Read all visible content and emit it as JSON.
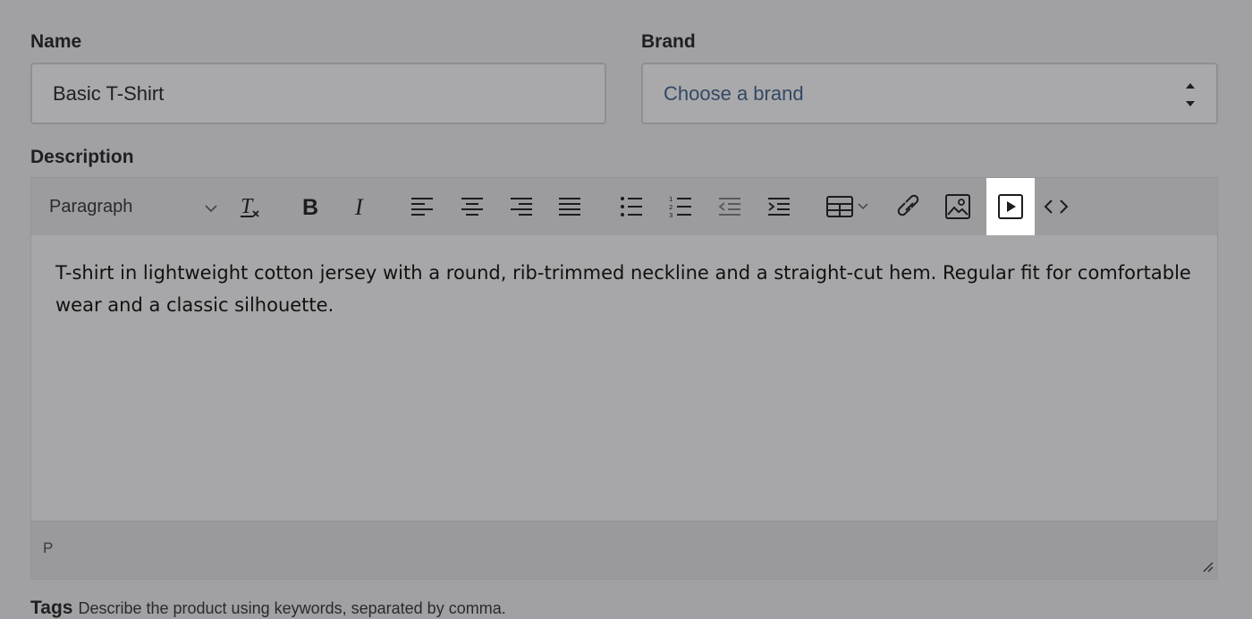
{
  "form": {
    "name_label": "Name",
    "name_value": "Basic T-Shirt",
    "brand_label": "Brand",
    "brand_placeholder": "Choose a brand",
    "description_label": "Description",
    "tags_label": "Tags",
    "tags_help": "Describe the product using keywords, separated by comma."
  },
  "editor": {
    "block_format": "Paragraph",
    "toolbar_icons": [
      "clear-formatting-icon",
      "bold-icon",
      "italic-icon",
      "align-left-icon",
      "align-center-icon",
      "align-right-icon",
      "justify-icon",
      "bullet-list-icon",
      "numbered-list-icon",
      "outdent-icon",
      "indent-icon",
      "table-icon",
      "link-icon",
      "image-icon",
      "media-icon",
      "code-icon"
    ],
    "active_tool": "media-icon",
    "content": "T-shirt in lightweight cotton jersey with a round, rib-trimmed neckline and a straight-cut hem. Regular fit for comfortable wear and a classic silhouette.",
    "element_path": "P"
  }
}
